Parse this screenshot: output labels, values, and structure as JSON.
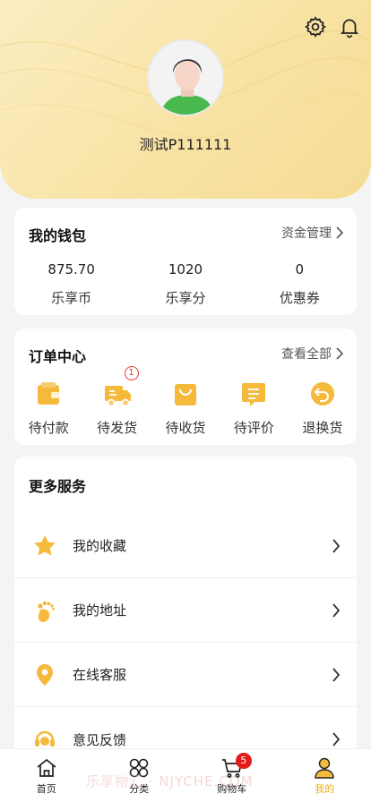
{
  "profile": {
    "username": "测试P111111"
  },
  "wallet": {
    "title": "我的钱包",
    "link": "资金管理",
    "items": [
      {
        "value": "875.70",
        "label": "乐享币"
      },
      {
        "value": "1020",
        "label": "乐享分"
      },
      {
        "value": "0",
        "label": "优惠券"
      }
    ]
  },
  "orders": {
    "title": "订单中心",
    "link": "查看全部",
    "items": [
      {
        "label": "待付款",
        "icon": "wallet-icon"
      },
      {
        "label": "待发货",
        "icon": "truck-icon",
        "badge": "1"
      },
      {
        "label": "待收货",
        "icon": "bag-icon"
      },
      {
        "label": "待评价",
        "icon": "comment-icon"
      },
      {
        "label": "退换货",
        "icon": "return-icon"
      }
    ]
  },
  "services": {
    "title": "更多服务",
    "items": [
      {
        "label": "我的收藏",
        "icon": "star-icon"
      },
      {
        "label": "我的地址",
        "icon": "footprint-icon"
      },
      {
        "label": "在线客服",
        "icon": "location-pin-icon"
      },
      {
        "label": "意见反馈",
        "icon": "headset-icon"
      }
    ]
  },
  "tabbar": {
    "items": [
      {
        "label": "首页",
        "icon": "home-icon"
      },
      {
        "label": "分类",
        "icon": "category-icon"
      },
      {
        "label": "购物车",
        "icon": "cart-icon",
        "badge": "5"
      },
      {
        "label": "我的",
        "icon": "user-icon",
        "active": true
      }
    ]
  },
  "watermark": "乐享物汇 · NJYCHE.COM",
  "colors": {
    "accent": "#f5b93b",
    "active_tab": "#e8b21c",
    "badge": "#e21b1b"
  }
}
